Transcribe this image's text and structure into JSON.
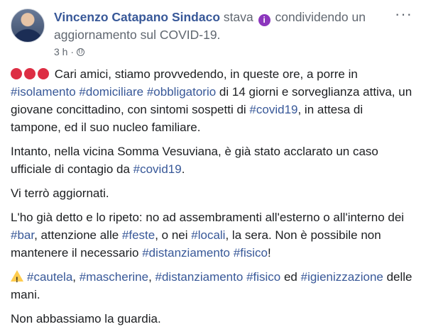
{
  "post": {
    "author": "Vincenzo Catapano Sindaco",
    "stava": "stava",
    "activity": "condividendo un aggiornamento sul COVID-19.",
    "activity_icon": "info-icon",
    "time": "3 h",
    "audience_icon": "globe-icon",
    "more": "···"
  },
  "content": {
    "p1": {
      "t0": " Cari amici, stiamo provvedendo, in queste ore, a porre in ",
      "h1": "#isolamento",
      "t1": " ",
      "h2": "#domiciliare",
      "t2": " ",
      "h3": "#obbligatorio",
      "t3": " di 14 giorni e sorveglianza attiva, un giovane concittadino, con sintomi sospetti di ",
      "h4": "#covid19",
      "t4": ", in attesa di tampone, ed il suo nucleo familiare."
    },
    "p2": {
      "t0": "Intanto, nella vicina Somma Vesuviana, è già stato acclarato un caso ufficiale di contagio da ",
      "h1": "#covid19",
      "t1": "."
    },
    "p3": "Vi terrò aggiornati.",
    "p4": {
      "t0": "L'ho già detto e lo ripeto: no ad assembramenti all'esterno o all'interno dei ",
      "h1": "#bar",
      "t1": ", attenzione alle ",
      "h2": "#feste",
      "t2": ", o nei ",
      "h3": "#locali",
      "t3": ", la sera. Non è possibile non mantenere il necessario ",
      "h4": "#distanziamento",
      "t4": " ",
      "h5": "#fisico",
      "t5": "!"
    },
    "p5": {
      "h1": "#cautela",
      "t1": ", ",
      "h2": "#mascherine",
      "t2": ", ",
      "h3": "#distanziamento",
      "t3": " ",
      "h4": "#fisico",
      "t4": " ed ",
      "h5": "#igienizzazione",
      "t5": " delle mani."
    },
    "p6": "Non abbassiamo la guardia."
  },
  "colors": {
    "link": "#385898",
    "text": "#1c1e21",
    "meta": "#606770",
    "red_circle": "#dd2e44",
    "warning": "#ffcc4d",
    "activity_icon_bg": "#8c36bd"
  }
}
